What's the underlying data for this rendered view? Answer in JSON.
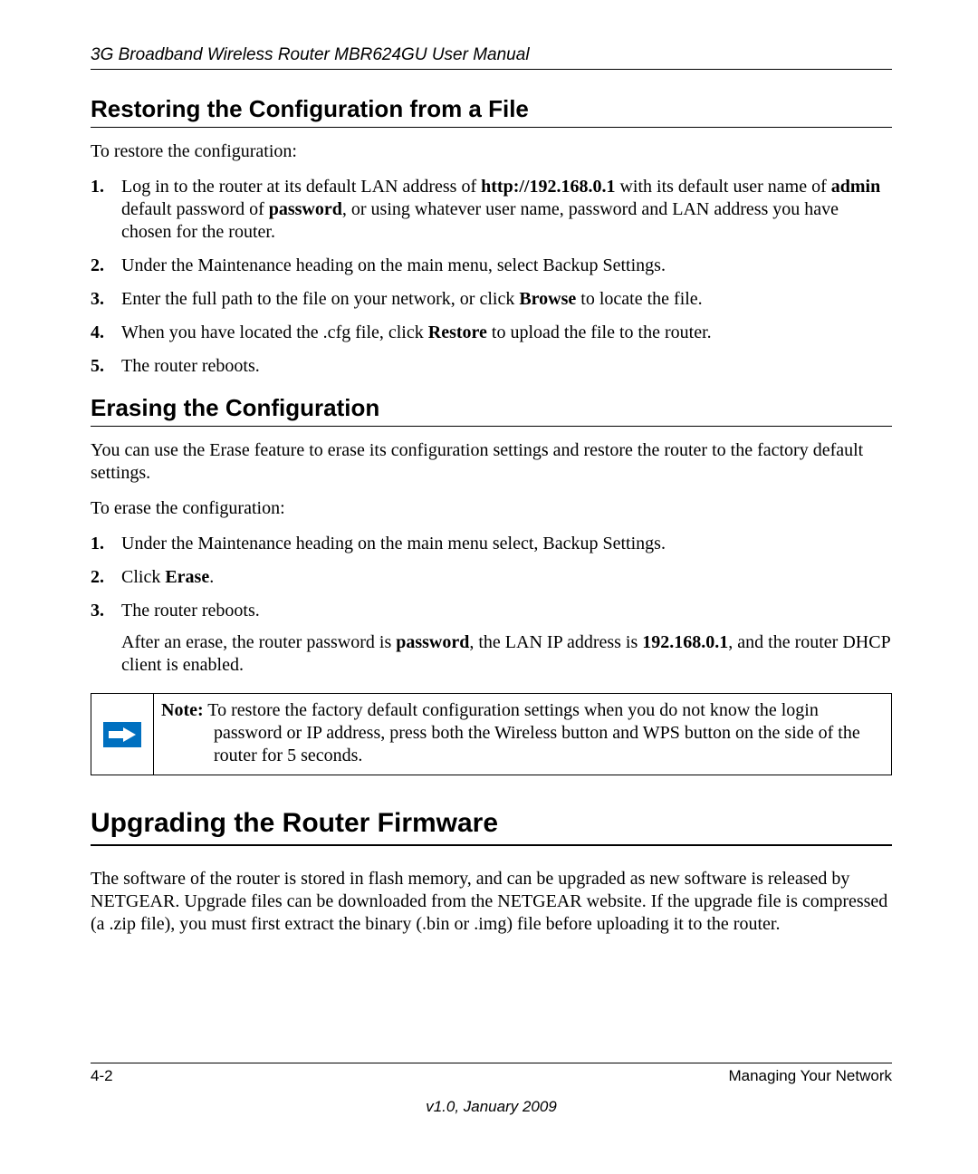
{
  "header": {
    "running_title": "3G Broadband Wireless Router MBR624GU User Manual"
  },
  "section1": {
    "title": "Restoring the Configuration from a File",
    "intro": "To restore the configuration:",
    "steps": {
      "s1a": "Log in to the router at its default LAN address of ",
      "s1_bold1": "http://192.168.0.1",
      "s1b": " with its default user name of ",
      "s1_bold2": "admin",
      "s1c": " default password of ",
      "s1_bold3": "password",
      "s1d": ", or using whatever user name, password and LAN address you have chosen for the router.",
      "s2": "Under the Maintenance heading on the main menu, select Backup Settings.",
      "s3a": "Enter the full path to the file on your network, or click ",
      "s3_bold": "Browse",
      "s3b": " to locate the file.",
      "s4a": "When you have located the .cfg file, click ",
      "s4_bold": "Restore",
      "s4b": " to upload the file to the router.",
      "s5": "The router reboots."
    }
  },
  "section2": {
    "title": "Erasing the Configuration",
    "intro": "You can use the Erase feature to erase its configuration settings and restore the router to the factory default settings.",
    "intro2": "To erase the configuration:",
    "steps": {
      "s1": "Under the Maintenance heading on the main menu select, Backup Settings.",
      "s2a": "Click ",
      "s2_bold": "Erase",
      "s2b": ".",
      "s3": "The router reboots.",
      "s3_suba": "After an erase, the router password is ",
      "s3_sub_bold1": "password",
      "s3_subb": ", the LAN IP address is ",
      "s3_sub_bold2": "192.168.0.1",
      "s3_subc": ", and the router DHCP client is enabled."
    },
    "note": {
      "label": "Note:",
      "text": " To restore the factory default configuration settings when you do not know the login password or IP address, press both the Wireless button and WPS button on the side of the router for 5 seconds."
    }
  },
  "section3": {
    "title": "Upgrading the Router Firmware",
    "body": "The software of the router is stored in flash memory, and can be upgraded as new software is released by NETGEAR. Upgrade files can be downloaded from the NETGEAR website. If the upgrade file is compressed (a .zip file), you must first extract the binary (.bin or .img) file before uploading it to the router."
  },
  "footer": {
    "page": "4-2",
    "chapter": "Managing Your Network",
    "version": "v1.0, January 2009"
  }
}
